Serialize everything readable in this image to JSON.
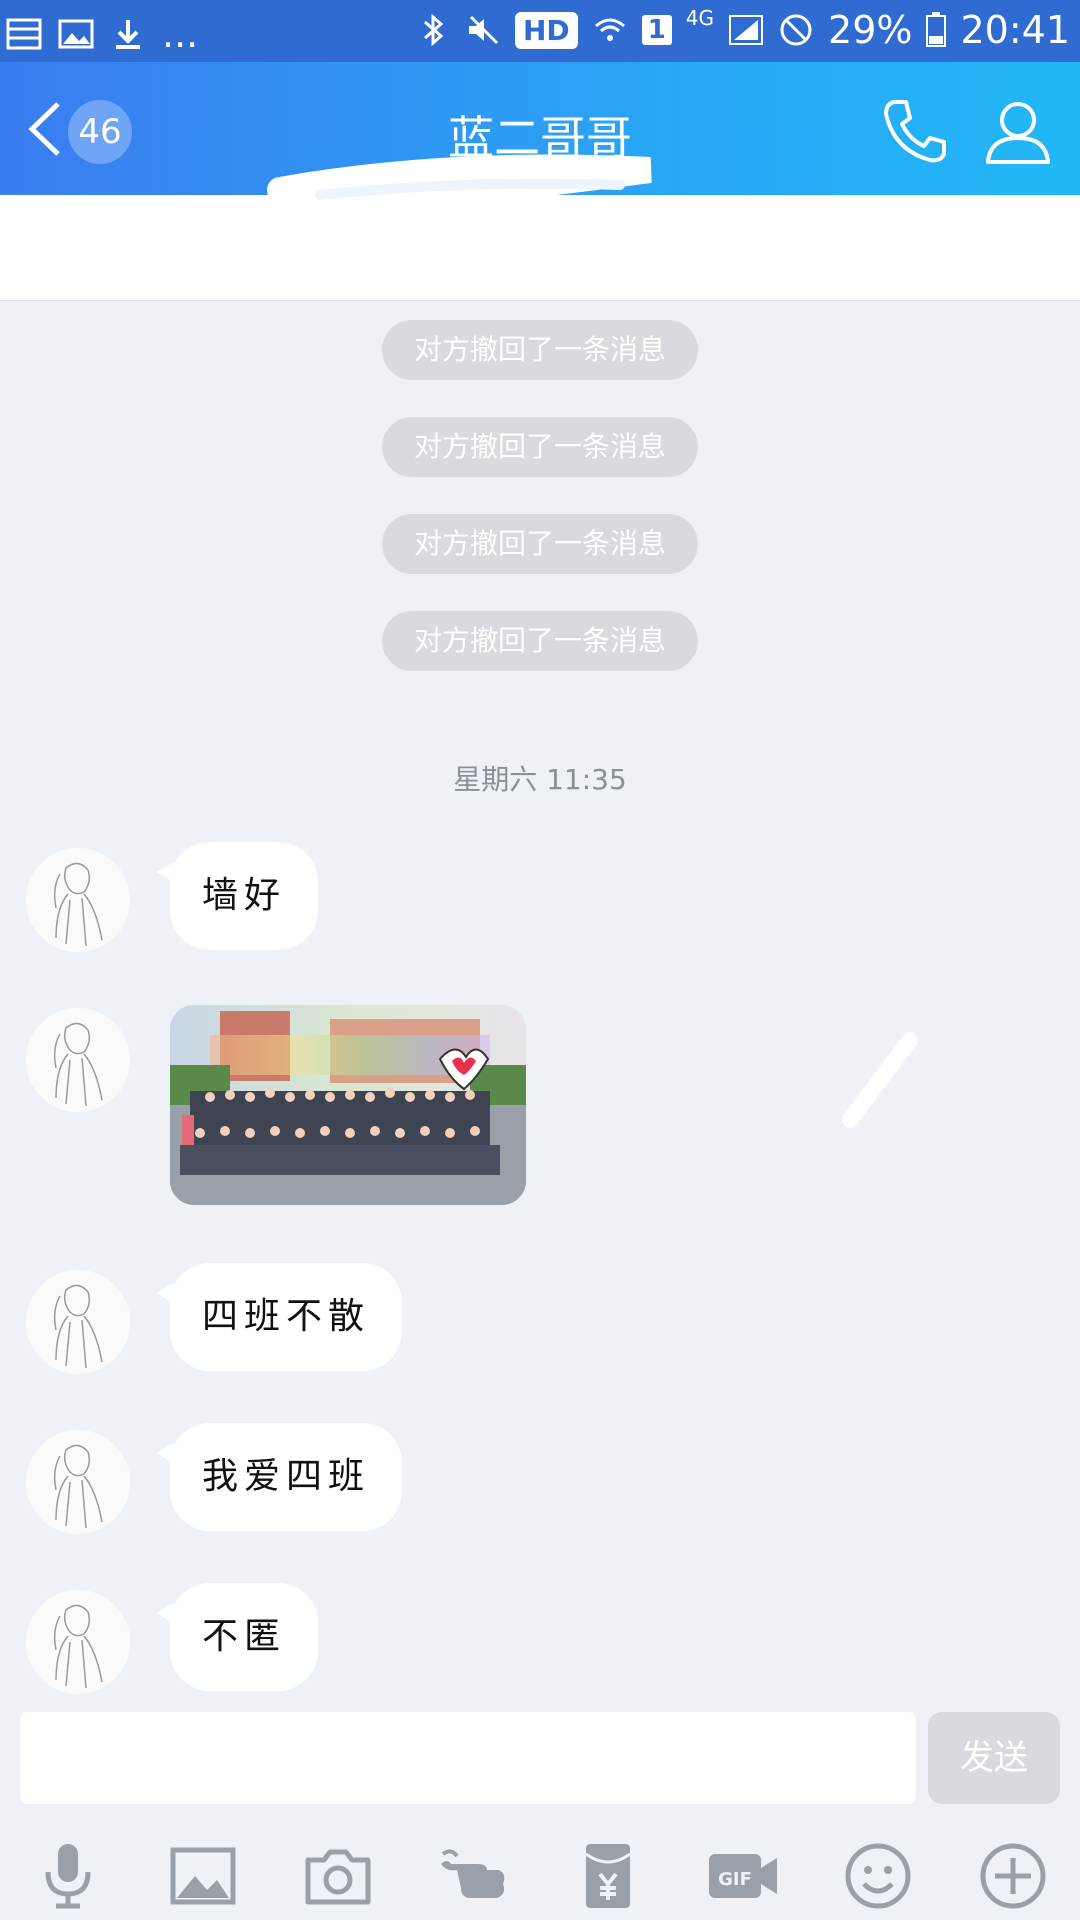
{
  "status_bar": {
    "battery": "29%",
    "time": "20:41",
    "hd": "HD",
    "sim": "1",
    "network": "4G",
    "more": "..."
  },
  "header": {
    "unread_count": "46",
    "title": "蓝二哥哥"
  },
  "system_messages": [
    "对方撤回了一条消息",
    "对方撤回了一条消息",
    "对方撤回了一条消息",
    "对方撤回了一条消息"
  ],
  "timestamp": "星期六 11:35",
  "messages": [
    {
      "type": "text",
      "text": "墙好"
    },
    {
      "type": "image"
    },
    {
      "type": "text",
      "text": "四班不散"
    },
    {
      "type": "text",
      "text": "我爱四班"
    },
    {
      "type": "text",
      "text": "不匿"
    }
  ],
  "input": {
    "value": "",
    "send_label": "发送"
  },
  "colors": {
    "header_start": "#3b7cf0",
    "header_end": "#22b8f6",
    "status_bar": "#2f6bd0",
    "background": "#eef1f6",
    "recall_pill": "#d7dadf"
  },
  "toolbar_icons": [
    "microphone-icon",
    "image-icon",
    "camera-icon",
    "poke-icon",
    "red-packet-icon",
    "gif-icon",
    "emoji-icon",
    "plus-icon"
  ]
}
